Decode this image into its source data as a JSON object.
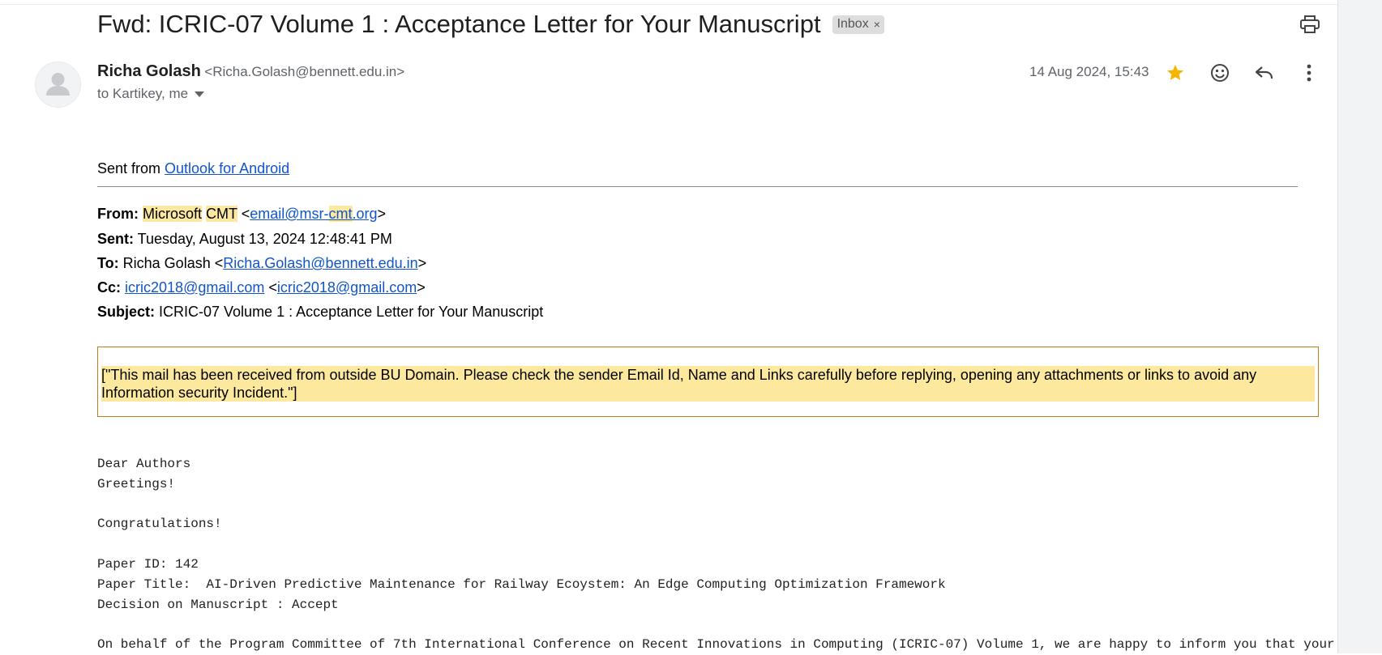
{
  "email": {
    "subject": "Fwd: ICRIC-07 Volume 1 : Acceptance Letter for Your Manuscript",
    "label_chip": "Inbox",
    "label_remove": "×",
    "sender_name": "Richa Golash",
    "sender_email": "<Richa.Golash@bennett.edu.in>",
    "recipients": "to Kartikey, me",
    "date": "14 Aug 2024, 15:43"
  },
  "icons": {
    "print": "print-icon",
    "star": "star-icon",
    "emoji": "emoji-icon",
    "reply": "reply-icon",
    "more": "more-vert-icon",
    "avatar": "person-icon",
    "caret": "chevron-down-icon"
  },
  "colors": {
    "link": "#1155cc",
    "star": "#f4b400",
    "highlight": "#fce8a0",
    "warning_bg": "#fde99e",
    "warning_border": "#c07c1a"
  },
  "body": {
    "sent_from_prefix": "Sent from ",
    "sent_from_link": "Outlook for Android",
    "forward": {
      "from_label": "From:",
      "from_word1": "Microsoft",
      "from_word2": "CMT",
      "from_lt": " <",
      "from_email_a": "email@msr-",
      "from_email_b": "cmt",
      "from_email_c": ".org",
      "gt": ">",
      "sent_label": "Sent:",
      "sent_value": " Tuesday, August 13, 2024 12:48:41 PM",
      "to_label": "To:",
      "to_name": " Richa Golash <",
      "to_email": "Richa.Golash@bennett.edu.in",
      "cc_label": "Cc:",
      "cc_email": "icric2018@gmail.com",
      "lt": " <",
      "subject_label": "Subject:",
      "subject_value": " ICRIC-07 Volume 1 : Acceptance Letter for Your Manuscript"
    },
    "warning": "[\"This mail has been received from outside BU Domain. Please check the sender Email Id, Name and Links carefully before replying, opening any attachments or links to avoid any Information security Incident.\"]",
    "message": "Dear Authors\nGreetings!\n\nCongratulations!\n\nPaper ID: 142\nPaper Title:  AI-Driven Predictive Maintenance for Railway Ecoystem: An Edge Computing Optimization Framework\nDecision on Manuscript : Accept\n\nOn behalf of the Program Committee of 7th International Conference on Recent Innovations in Computing (ICRIC-07) Volume 1, we are happy to inform you that your"
  }
}
